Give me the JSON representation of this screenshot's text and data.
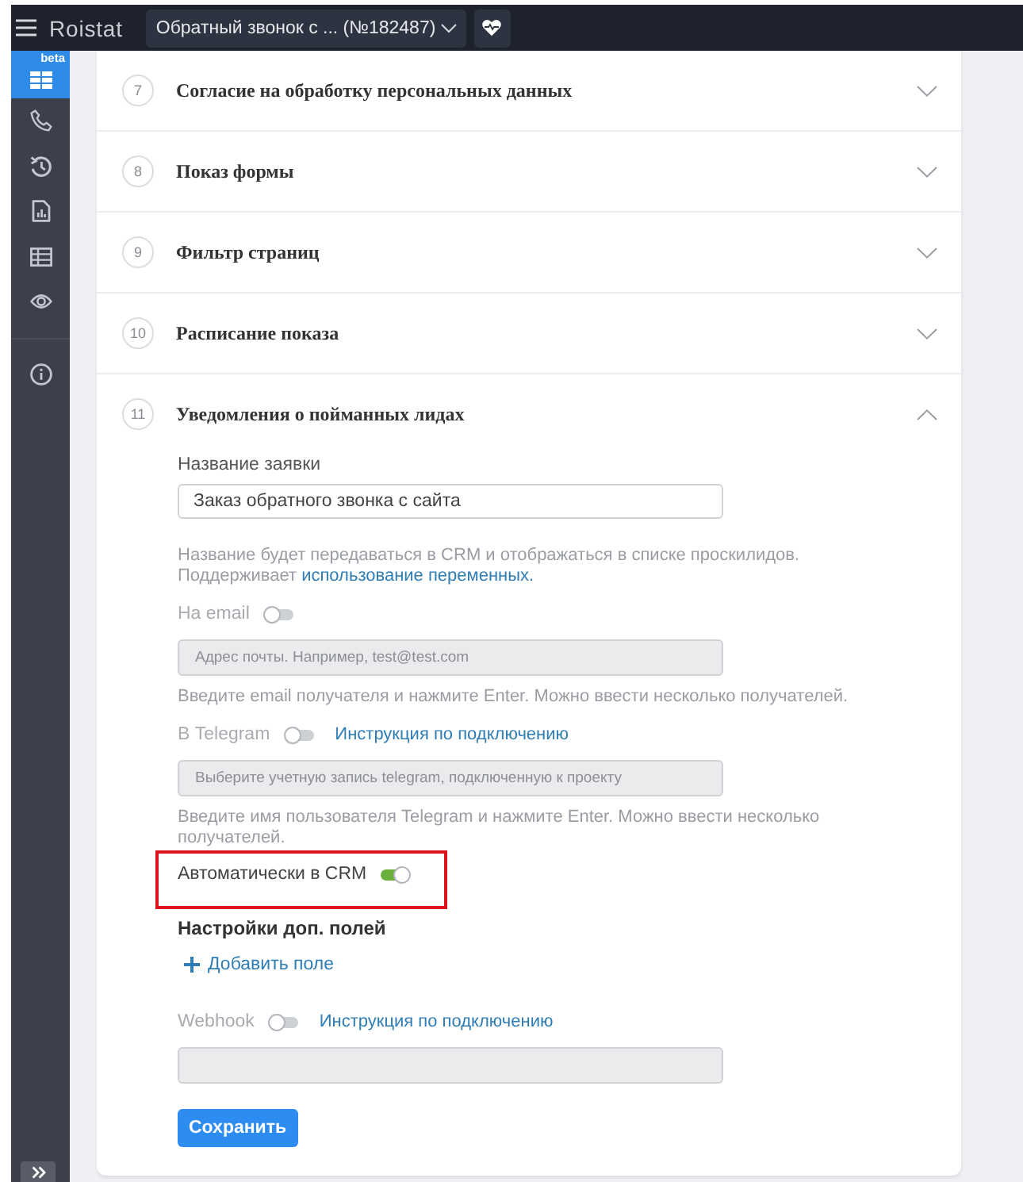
{
  "topbar": {
    "logo": "Roistat",
    "project": "Обратный звонок с ... (№182487)"
  },
  "sidebar": {
    "items": [
      {
        "badge": "beta",
        "selected": true
      },
      {
        "selected": false
      },
      {
        "selected": false
      },
      {
        "selected": false
      },
      {
        "selected": false
      },
      {
        "selected": false
      }
    ],
    "bottom_items": [
      {
        "selected": false
      }
    ]
  },
  "sections": [
    {
      "number": "7",
      "title": "Согласие на обработку персональных данных",
      "expanded": false
    },
    {
      "number": "8",
      "title": "Показ формы",
      "expanded": false
    },
    {
      "number": "9",
      "title": "Фильтр страниц",
      "expanded": false
    },
    {
      "number": "10",
      "title": "Расписание показа",
      "expanded": false
    },
    {
      "number": "11",
      "title": "Уведомления о пойманных лидах",
      "expanded": true,
      "form": {
        "name_label": "Название заявки",
        "name_value": "Заказ обратного звонка с сайта",
        "name_help": "Название будет передаваться в CRM и отображаться в списке проскилидов. Поддерживает",
        "name_help_link": "использование переменных.",
        "channels": [
          {
            "kind": "toggle_field",
            "label": "На email",
            "on": false,
            "placeholder": "Адрес почты. Например, test@test.com",
            "disabled": true,
            "help": "Введите email получателя и нажмите Enter. Можно ввести несколько получателей."
          },
          {
            "kind": "toggle_field",
            "label": "В Telegram",
            "on": false,
            "link": "Инструкция по подключению",
            "placeholder": "Выберите учетную запись telegram, подключенную к проекту",
            "disabled": true,
            "help": "Введите имя пользователя Telegram и нажмите Enter. Можно ввести несколько получателей."
          },
          {
            "kind": "toggle",
            "label": "Автоматически в CRM",
            "on": true,
            "highlighted": true
          },
          {
            "kind": "extra_fields",
            "title": "Настройки доп. полей",
            "add_label": "Добавить поле"
          },
          {
            "kind": "toggle_field",
            "label": "Webhook",
            "on": false,
            "link": "Инструкция по подключению",
            "disabled": true
          }
        ],
        "save": "Сохранить"
      }
    }
  ]
}
